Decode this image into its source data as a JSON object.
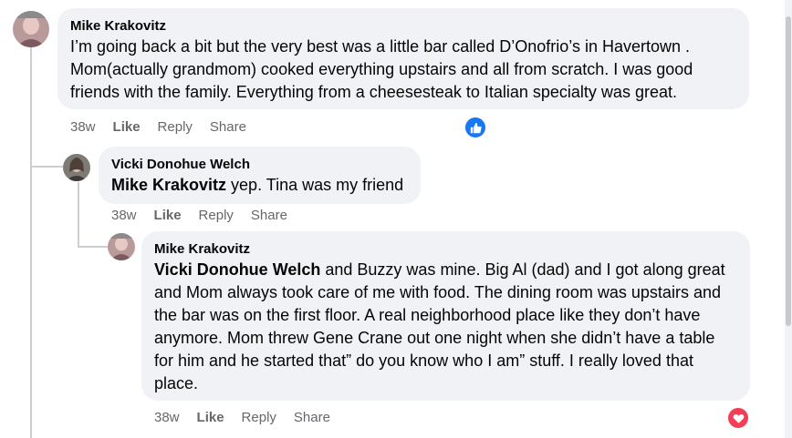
{
  "comments": [
    {
      "author": "Mike Krakovitz",
      "text": "I’m going back a bit but the very best was a little bar called D’Onofrio’s in Havertown . Mom(actually grandmom) cooked everything upstairs and all from scratch. I was good friends with the family. Everything from a cheesesteak to Italian specialty was great.",
      "time": "38w",
      "like": "Like",
      "reply": "Reply",
      "share": "Share",
      "reaction": "like-reaction-icon"
    },
    {
      "author": "Vicki Donohue Welch",
      "mention": "Mike Krakovitz",
      "text": " yep. Tina was my friend",
      "time": "38w",
      "like": "Like",
      "reply": "Reply",
      "share": "Share"
    },
    {
      "author": "Mike Krakovitz",
      "mention": "Vicki Donohue Welch",
      "text": " and Buzzy was mine. Big Al (dad) and I got along great and Mom always took care of me with food. The dining room was upstairs and the bar was on the first floor. A real neighborhood place like they don’t have anymore. Mom threw Gene Crane out one night when she didn’t have a table for him and he started that” do you know who I am” stuff. I really loved that place.",
      "time": "38w",
      "like": "Like",
      "reply": "Reply",
      "share": "Share",
      "reaction": "love-reaction-icon"
    }
  ],
  "colors": {
    "like_blue": "#1877f2",
    "love_red": "#f33e58",
    "bubble": "#f0f2f5",
    "meta_gray": "#65676b"
  }
}
